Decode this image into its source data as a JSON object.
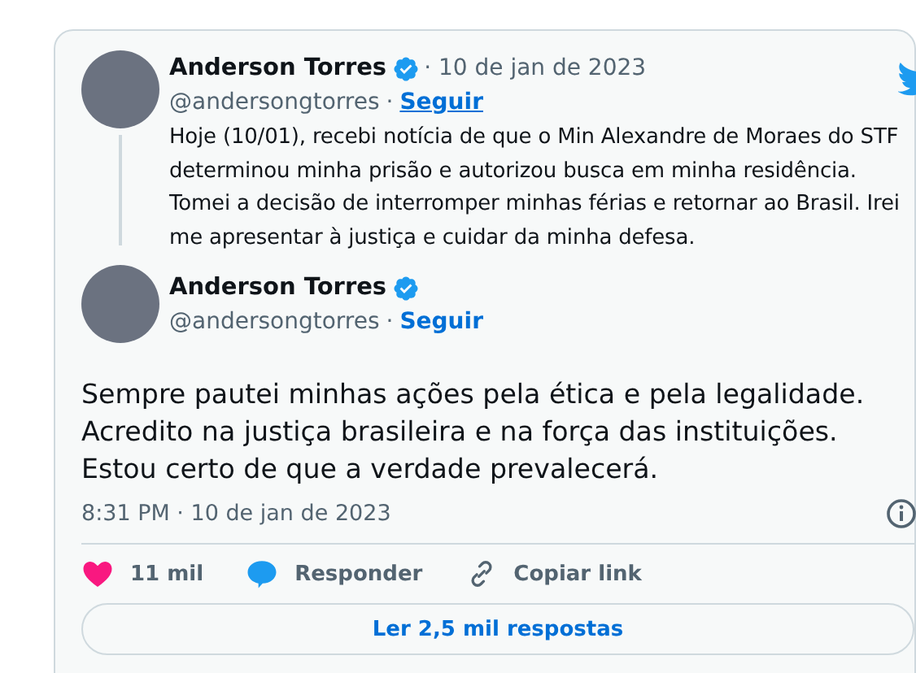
{
  "quoted_tweet": {
    "name": "Anderson Torres",
    "verified": true,
    "date": "· 10 de jan de 2023",
    "handle": "@andersongtorres",
    "separator": "·",
    "follow": "Seguir",
    "text": "Hoje (10/01), recebi notícia de que o Min Alexandre de Moraes do STF determinou minha prisão e autorizou busca em minha residência. Tomei a decisão de interromper minhas férias e retornar ao Brasil. Irei me apresentar à justiça e cuidar da minha defesa."
  },
  "tweet": {
    "name": "Anderson Torres",
    "verified": true,
    "handle": "@andersongtorres",
    "separator": "·",
    "follow": "Seguir",
    "text": "Sempre pautei minhas ações pela ética e pela legalidade. Acredito na justiça brasileira e na força das instituições. Estou certo de que a verdade prevalecerá.",
    "timestamp": "8:31 PM · 10 de jan de 2023"
  },
  "actions": [
    {
      "kind": "like",
      "label": "11 mil"
    },
    {
      "kind": "reply",
      "label": "Responder"
    },
    {
      "kind": "link",
      "label": "Copiar link"
    }
  ],
  "replies_button": "Ler 2,5 mil respostas"
}
